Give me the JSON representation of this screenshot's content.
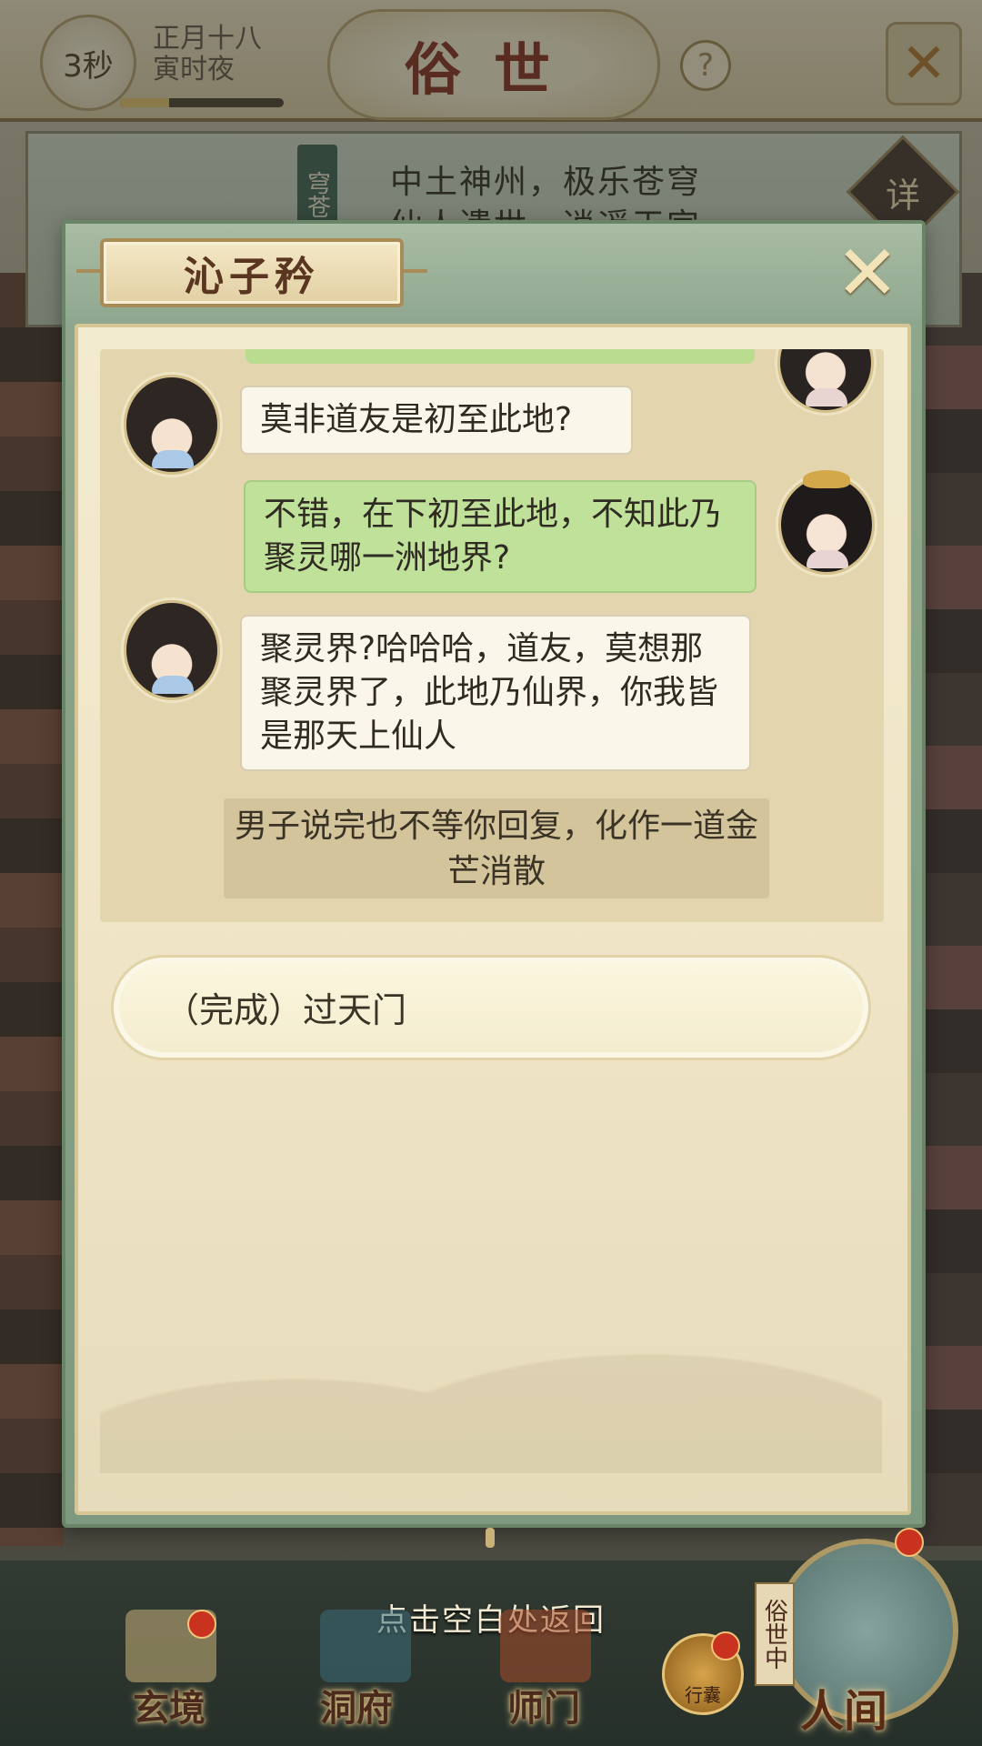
{
  "top_bar": {
    "timer": "3秒",
    "date_line1": "正月十八",
    "date_line2": "寅时夜",
    "title": "俗世",
    "help": "?",
    "close": "✕",
    "progress": 0.3
  },
  "banner": {
    "vertical_label": "穹苍",
    "line1": "中土神州，极乐苍穹",
    "line2": "仙人遗世，逍遥天宫",
    "detail": "详"
  },
  "dialog": {
    "npc_name": "沁子矜",
    "close": "✕",
    "messages": [
      {
        "speaker": "npc",
        "text": "莫非道友是初至此地?"
      },
      {
        "speaker": "player",
        "text": "不错，在下初至此地，不知此乃聚灵哪一洲地界?"
      },
      {
        "speaker": "npc",
        "text": "聚灵界?哈哈哈，道友，莫想那聚灵界了，此地乃仙界，你我皆是那天上仙人"
      }
    ],
    "narration": "男子说完也不等你回复，化作一道金芒消散",
    "option": "（完成）过天门"
  },
  "bottom": {
    "tap_hint": "点击空白处返回",
    "nav": [
      {
        "label": "玄境",
        "badge": true
      },
      {
        "label": "洞府",
        "badge": false
      },
      {
        "label": "师门",
        "badge": false
      }
    ],
    "bag_label": "行囊",
    "world_vertical": "俗世中",
    "world_label": "人间"
  }
}
